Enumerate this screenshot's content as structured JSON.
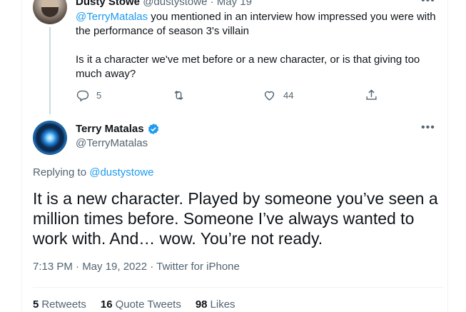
{
  "parent_tweet": {
    "author_name": "Dusty Stowe",
    "author_handle": "@dustystowe",
    "separator": "·",
    "date": "May 19",
    "text_lines": [
      "the performance of season 3's villain",
      "",
      "Is it a character we've met before or a new character, or is that giving too",
      "much away?"
    ],
    "mention": "@TerryMatalas",
    "first_line_rest": " you mentioned in an interview how impressed you were with",
    "more_icon": "more-horizontal-icon",
    "actions": {
      "reply": {
        "icon": "reply-icon",
        "count": "5"
      },
      "retweet": {
        "icon": "retweet-icon",
        "count": ""
      },
      "like": {
        "icon": "heart-icon",
        "count": "44"
      },
      "share": {
        "icon": "share-icon",
        "count": ""
      }
    }
  },
  "main_tweet": {
    "author_name": "Terry Matalas",
    "author_handle": "@TerryMatalas",
    "verified_icon": "verified-badge-icon",
    "more_icon": "more-horizontal-icon",
    "replying_prefix": "Replying to ",
    "replying_to": "@dustystowe",
    "text_lines": [
      "It is a new character. Played by someone you’ve seen a",
      "million times before. Someone I’ve always wanted to",
      "work with. And… wow. You’re not ready."
    ],
    "meta": "7:13 PM · May 19, 2022 · Twitter for iPhone",
    "stats": [
      {
        "count": "5",
        "label": "Retweets"
      },
      {
        "count": "16",
        "label": "Quote Tweets"
      },
      {
        "count": "98",
        "label": "Likes"
      }
    ]
  },
  "colors": {
    "accent": "#1d9bf0",
    "secondary_text": "#536471",
    "primary_text": "#0f1419",
    "border": "#eff3f4"
  }
}
